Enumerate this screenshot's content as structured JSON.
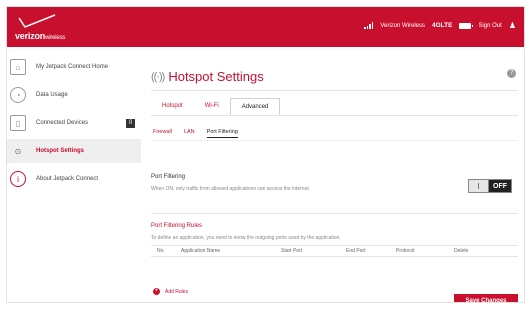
{
  "header": {
    "brand": "verizon",
    "brand_suffix": "wireless",
    "network_name": "Verizon Wireless",
    "network_type": "4GLTE",
    "signout_label": "Sign Out",
    "colors": {
      "bar": "#c8102e"
    }
  },
  "sidebar": {
    "items": [
      {
        "label": "My Jetpack Connect Home",
        "icon": "home-icon"
      },
      {
        "label": "Data Usage",
        "icon": "gauge-icon"
      },
      {
        "label": "Connected Devices",
        "icon": "devices-icon",
        "badge": "0"
      },
      {
        "label": "Hotspot Settings",
        "icon": "hotspot-icon"
      },
      {
        "label": "About Jetpack Connect",
        "icon": "info-icon"
      }
    ]
  },
  "page": {
    "title": "Hotspot Settings",
    "tabs": [
      "Hotspot",
      "Wi-Fi",
      "Advanced"
    ],
    "subtabs": [
      "Firewall",
      "LAN",
      "Port Filtering"
    ],
    "port_filtering": {
      "label": "Port Filtering",
      "description": "When ON, only traffic from allowed applications can access the internet.",
      "state": "OFF"
    },
    "rules": {
      "title": "Port Filtering Rules",
      "description": "To define an application, you need to know the outgoing ports used by the application.",
      "columns": [
        "No.",
        "Application Name",
        "Start Port",
        "End Port",
        "Protocol",
        "Delete"
      ],
      "add_label": "Add Rules"
    },
    "save_label": "Save Changes"
  }
}
